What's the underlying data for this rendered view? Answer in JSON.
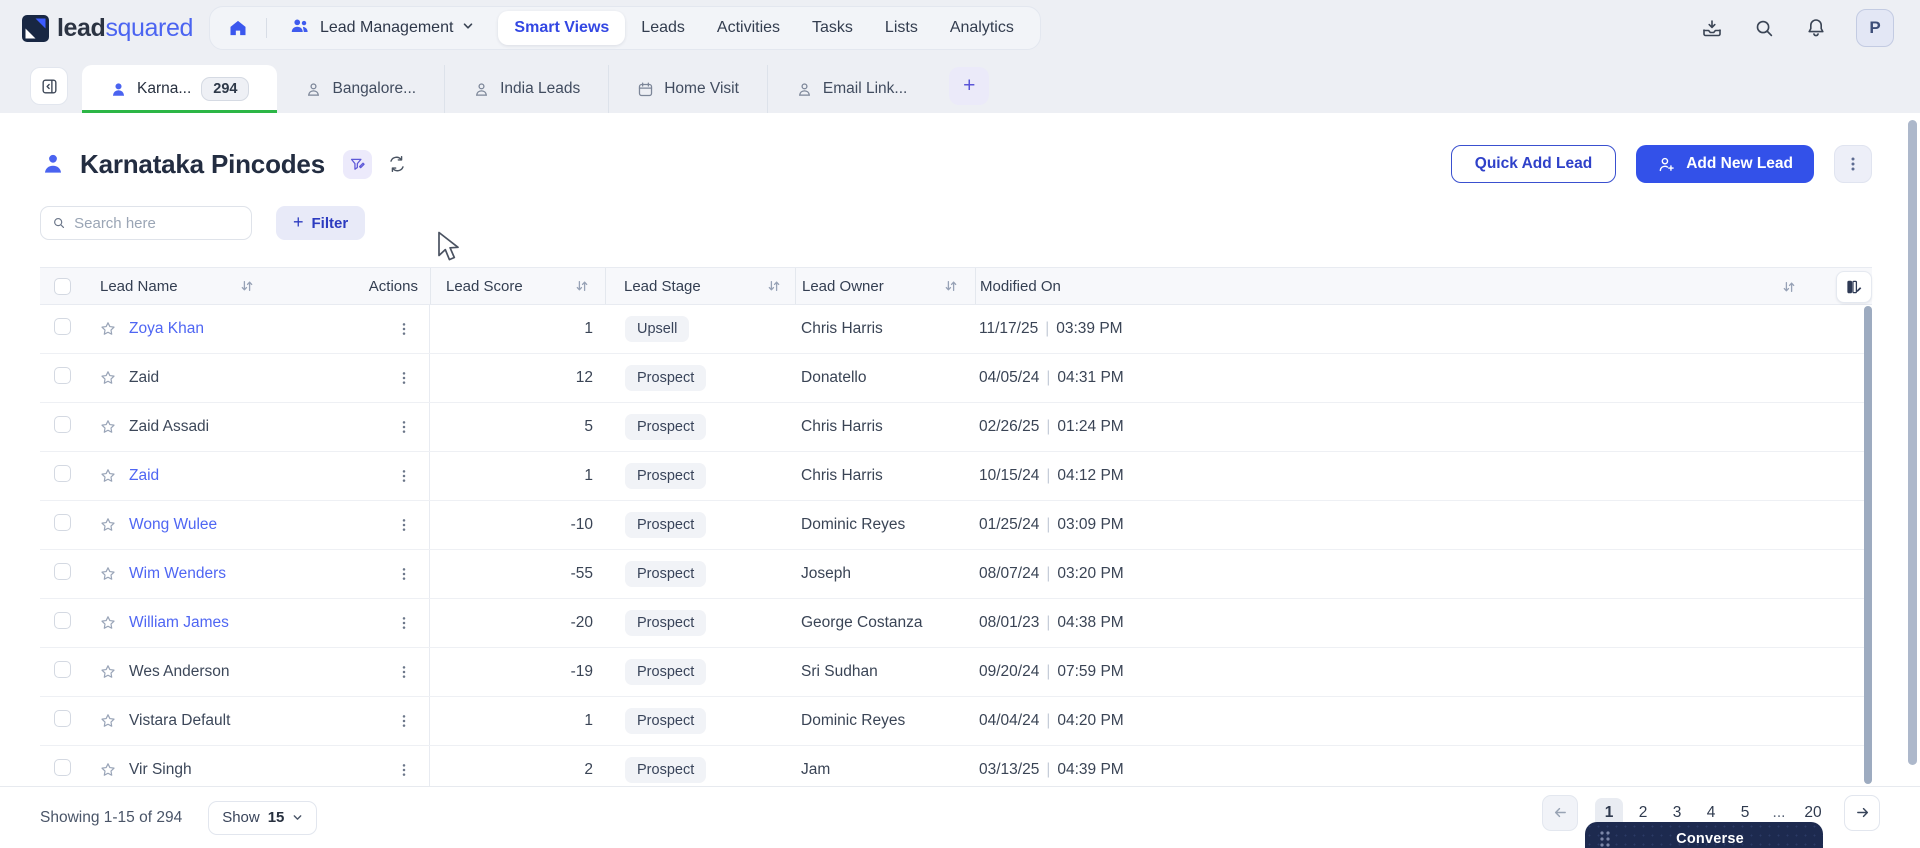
{
  "topbar": {
    "logo_lead": "lead",
    "logo_squared": "squared",
    "lead_management": "Lead Management",
    "nav_items": [
      {
        "label": "Smart Views",
        "active": true
      },
      {
        "label": "Leads",
        "active": false
      },
      {
        "label": "Activities",
        "active": false
      },
      {
        "label": "Tasks",
        "active": false
      },
      {
        "label": "Lists",
        "active": false
      },
      {
        "label": "Analytics",
        "active": false
      }
    ],
    "avatar_initial": "P"
  },
  "tabbar": {
    "tabs": [
      {
        "label": "Karna...",
        "badge": "294",
        "icon": "person",
        "active": true
      },
      {
        "label": "Bangalore...",
        "icon": "person",
        "active": false
      },
      {
        "label": "India Leads",
        "icon": "person",
        "active": false
      },
      {
        "label": "Home Visit",
        "icon": "calendar",
        "active": false
      },
      {
        "label": "Email Link...",
        "icon": "person",
        "active": false
      }
    ],
    "add_tab_label": "+"
  },
  "header": {
    "title": "Karnataka Pincodes",
    "quick_add_label": "Quick Add Lead",
    "add_new_label": "Add New Lead"
  },
  "toolbar": {
    "search_placeholder": "Search here",
    "filter_plus": "+",
    "filter_label": "Filter"
  },
  "table": {
    "columns": {
      "lead_name": "Lead Name",
      "actions": "Actions",
      "lead_score": "Lead Score",
      "lead_stage": "Lead Stage",
      "lead_owner": "Lead Owner",
      "modified_on": "Modified On"
    },
    "date_separator": "|",
    "rows": [
      {
        "name": "Zoya Khan",
        "is_link": true,
        "score": "1",
        "stage": "Upsell",
        "owner": "Chris Harris",
        "date": "11/17/25",
        "time": "03:39 PM"
      },
      {
        "name": "Zaid",
        "is_link": false,
        "score": "12",
        "stage": "Prospect",
        "owner": "Donatello",
        "date": "04/05/24",
        "time": "04:31 PM"
      },
      {
        "name": "Zaid Assadi",
        "is_link": false,
        "score": "5",
        "stage": "Prospect",
        "owner": "Chris Harris",
        "date": "02/26/25",
        "time": "01:24 PM"
      },
      {
        "name": "Zaid",
        "is_link": true,
        "score": "1",
        "stage": "Prospect",
        "owner": "Chris Harris",
        "date": "10/15/24",
        "time": "04:12 PM"
      },
      {
        "name": "Wong Wulee",
        "is_link": true,
        "score": "-10",
        "stage": "Prospect",
        "owner": "Dominic Reyes",
        "date": "01/25/24",
        "time": "03:09 PM"
      },
      {
        "name": "Wim Wenders",
        "is_link": true,
        "score": "-55",
        "stage": "Prospect",
        "owner": "Joseph",
        "date": "08/07/24",
        "time": "03:20 PM"
      },
      {
        "name": "William James",
        "is_link": true,
        "score": "-20",
        "stage": "Prospect",
        "owner": "George Costanza",
        "date": "08/01/23",
        "time": "04:38 PM"
      },
      {
        "name": "Wes Anderson",
        "is_link": false,
        "score": "-19",
        "stage": "Prospect",
        "owner": "Sri Sudhan",
        "date": "09/20/24",
        "time": "07:59 PM"
      },
      {
        "name": "Vistara Default",
        "is_link": false,
        "score": "1",
        "stage": "Prospect",
        "owner": "Dominic Reyes",
        "date": "04/04/24",
        "time": "04:20 PM"
      },
      {
        "name": "Vir Singh",
        "is_link": false,
        "score": "2",
        "stage": "Prospect",
        "owner": "Jam",
        "date": "03/13/25",
        "time": "04:39 PM"
      }
    ]
  },
  "footer": {
    "showing_text": "Showing 1-15 of 294",
    "show_label": "Show",
    "show_value": "15",
    "pages": [
      {
        "label": "1",
        "active": true
      },
      {
        "label": "2"
      },
      {
        "label": "3"
      },
      {
        "label": "4"
      },
      {
        "label": "5"
      },
      {
        "label": "...",
        "ellipsis": true
      },
      {
        "label": "20"
      }
    ]
  },
  "converse_label": "Converse",
  "colors": {
    "accent_blue": "#3351e9",
    "link_blue": "#4f66f3",
    "active_tab_green": "#2cb646",
    "converse_navy": "#1d2a4f"
  }
}
